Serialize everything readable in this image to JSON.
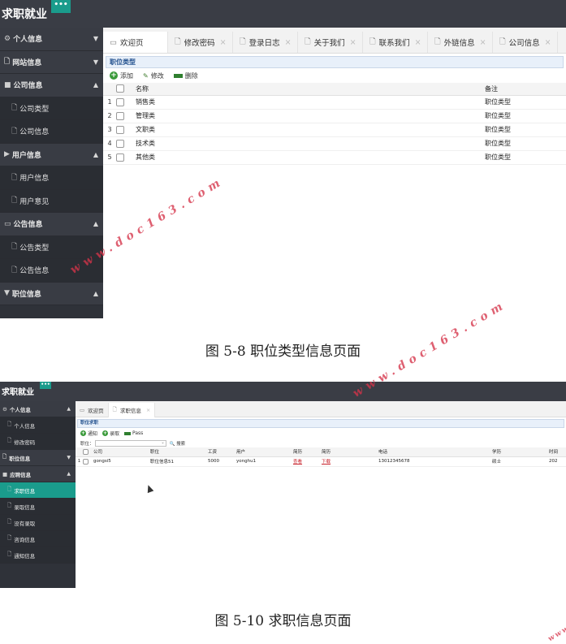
{
  "shot1": {
    "brand": "求职就业",
    "toggle": "•••",
    "sidebar": [
      {
        "label": "个人信息",
        "kind": "group-collapsed",
        "icon": "gear-icon"
      },
      {
        "label": "网站信息",
        "kind": "group-collapsed",
        "icon": "file-icon"
      },
      {
        "label": "公司信息",
        "kind": "group-open",
        "icon": "folder-icon"
      },
      {
        "label": "公司类型",
        "kind": "sub",
        "icon": "file-icon"
      },
      {
        "label": "公司信息",
        "kind": "sub",
        "icon": "file-icon"
      },
      {
        "label": "用户信息",
        "kind": "group-open",
        "icon": "play-icon"
      },
      {
        "label": "用户信息",
        "kind": "sub",
        "icon": "file-icon"
      },
      {
        "label": "用户意见",
        "kind": "sub",
        "icon": "file-icon"
      },
      {
        "label": "公告信息",
        "kind": "group-open",
        "icon": "monitor-icon"
      },
      {
        "label": "公告类型",
        "kind": "sub",
        "icon": "file-icon"
      },
      {
        "label": "公告信息",
        "kind": "sub",
        "icon": "file-icon"
      },
      {
        "label": "职位信息",
        "kind": "group-open",
        "icon": "caret-down-icon"
      }
    ],
    "tabs": [
      "欢迎页",
      "修改密码",
      "登录日志",
      "关于我们",
      "联系我们",
      "外链信息",
      "公司信息"
    ],
    "panel_title": "职位类型",
    "toolbar": {
      "add": "添加",
      "edit": "修改",
      "delete": "删除"
    },
    "columns": {
      "name": "名称",
      "note": "备注"
    },
    "rows": [
      {
        "num": "1",
        "name": "销售类",
        "note": "职位类型"
      },
      {
        "num": "2",
        "name": "管理类",
        "note": "职位类型"
      },
      {
        "num": "3",
        "name": "文职类",
        "note": "职位类型"
      },
      {
        "num": "4",
        "name": "技术类",
        "note": "职位类型"
      },
      {
        "num": "5",
        "name": "其他类",
        "note": "职位类型"
      }
    ]
  },
  "caption1": "图 5-8 职位类型信息页面",
  "shot2": {
    "brand": "求职就业",
    "toggle": "•••",
    "sidebar": [
      {
        "label": "个人信息",
        "kind": "group-open",
        "icon": "gear-icon"
      },
      {
        "label": "个人信息",
        "kind": "sub",
        "icon": "file-icon"
      },
      {
        "label": "修改密码",
        "kind": "sub",
        "icon": "file-icon"
      },
      {
        "label": "职位信息",
        "kind": "group-collapsed",
        "icon": "file-icon"
      },
      {
        "label": "应聘信息",
        "kind": "group-open",
        "icon": "folder-icon"
      },
      {
        "label": "求职信息",
        "kind": "active",
        "icon": "file-icon"
      },
      {
        "label": "录取信息",
        "kind": "sub",
        "icon": "file-icon"
      },
      {
        "label": "没有录取",
        "kind": "sub",
        "icon": "file-icon"
      },
      {
        "label": "咨询信息",
        "kind": "sub",
        "icon": "file-icon"
      },
      {
        "label": "通知信息",
        "kind": "sub",
        "icon": "file-icon"
      }
    ],
    "tabs": [
      "欢迎页",
      "求职信息"
    ],
    "panel_title": "职位求职",
    "toolbar": {
      "notify": "通知",
      "admit": "录取",
      "pass": "Pass"
    },
    "search": {
      "label": "职位：",
      "button": "搜索"
    },
    "columns": [
      "公司",
      "职位",
      "工资",
      "用户",
      "简历",
      "简历",
      "电话",
      "学历",
      "时间"
    ],
    "row": {
      "num": "1",
      "company": "gongsi5",
      "position": "职位信息51",
      "salary": "5000",
      "user": "yonghu1",
      "resume_view": "查看",
      "resume_download": "下载",
      "phone": "13012345678",
      "education": "硕士",
      "time": "202"
    }
  },
  "caption2": "图 5-10 求职信息页面",
  "watermark": "www.doc163.com",
  "colors": {
    "sidebar": "#2f3239",
    "topbar": "#3a3d45",
    "accent": "#1a9c8c",
    "link_red": "#c8232c",
    "watermark": "#d6344a"
  }
}
